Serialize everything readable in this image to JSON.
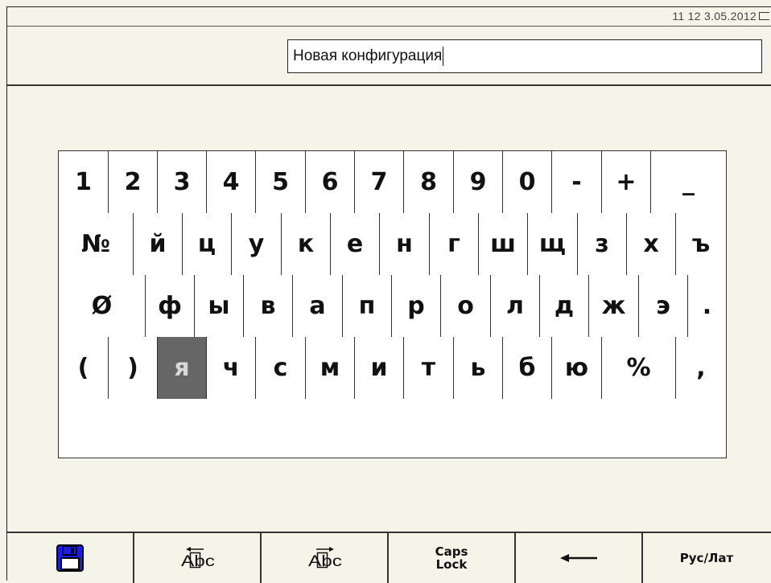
{
  "status_bar": {
    "clock": "11 12  3.05.2012"
  },
  "header": {
    "config_name": "Новая конфигурация"
  },
  "keyboard": {
    "rows": [
      [
        "1",
        "2",
        "3",
        "4",
        "5",
        "6",
        "7",
        "8",
        "9",
        "0",
        "-",
        "+",
        "_"
      ],
      [
        "№",
        "й",
        "ц",
        "у",
        "к",
        "е",
        "н",
        "г",
        "ш",
        "щ",
        "з",
        "х",
        "ъ"
      ],
      [
        "Ø",
        "ф",
        "ы",
        "в",
        "а",
        "п",
        "р",
        "о",
        "л",
        "д",
        "ж",
        "э",
        "."
      ],
      [
        "(",
        ")",
        "я",
        "ч",
        "с",
        "м",
        "и",
        "т",
        "ь",
        "б",
        "ю",
        "%",
        ","
      ]
    ],
    "selected_key": "я",
    "space_label": ""
  },
  "toolbar": {
    "save_icon": "floppy-disk-icon",
    "cursor_left_text": "Abc",
    "cursor_right_text": "Abc",
    "caps_label": "Caps\nLock",
    "backspace_icon": "left-arrow-icon",
    "lang_label": "Рус/Лат",
    "accent_color": "#1a1aff"
  }
}
